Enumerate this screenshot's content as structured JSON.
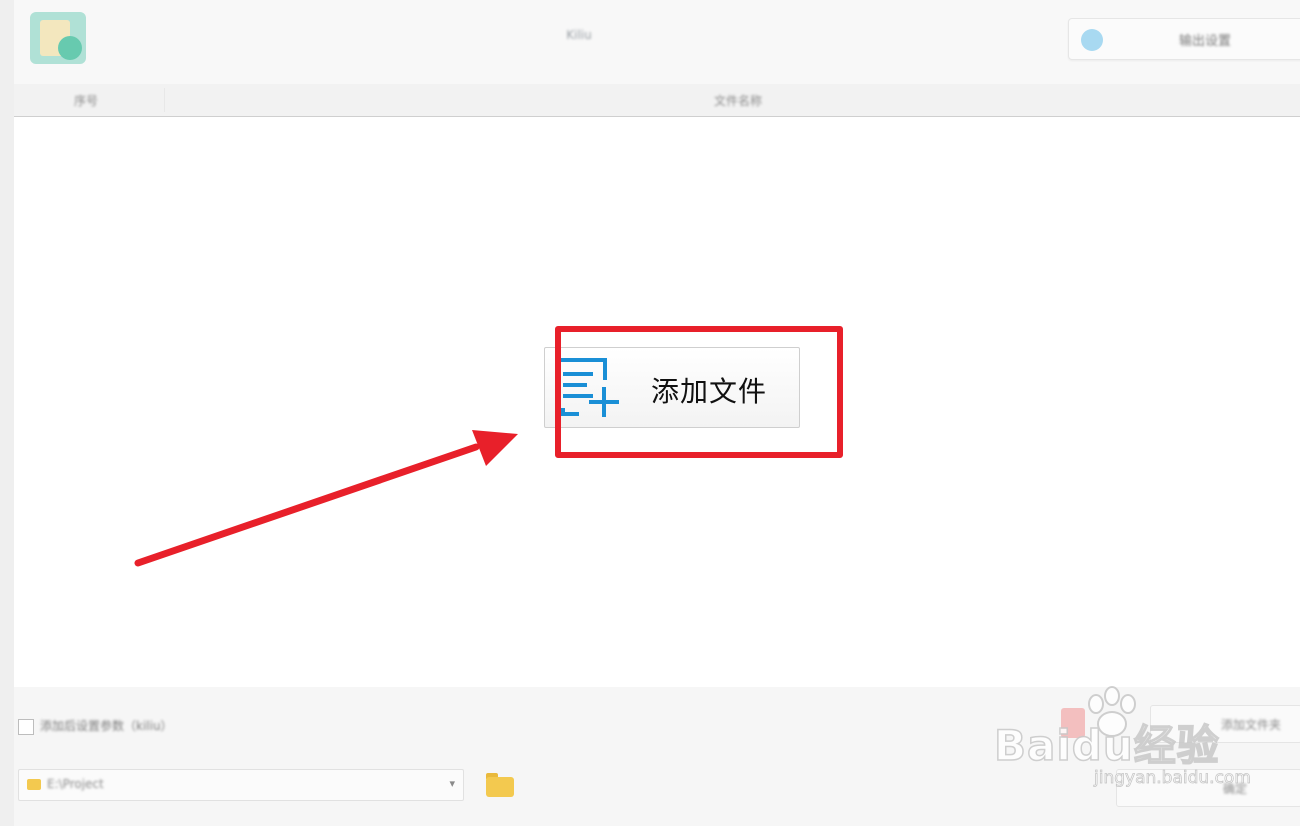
{
  "window": {
    "title": "Kiliu",
    "output_button_label": "输出设置"
  },
  "table": {
    "columns": [
      "序号",
      "文件名称"
    ]
  },
  "main": {
    "add_file_label": "添加文件"
  },
  "bottom": {
    "checkbox_label": "添加后设置参数（kiliu）",
    "output_path": "E:\\Project",
    "add_folder_label": "添加文件夹",
    "confirm_label": "确定"
  },
  "watermark": {
    "brand": "Baidu经验",
    "url": "jingyan.baidu.com"
  },
  "colors": {
    "highlight": "#e8202a",
    "icon_blue": "#1a8fd6"
  }
}
